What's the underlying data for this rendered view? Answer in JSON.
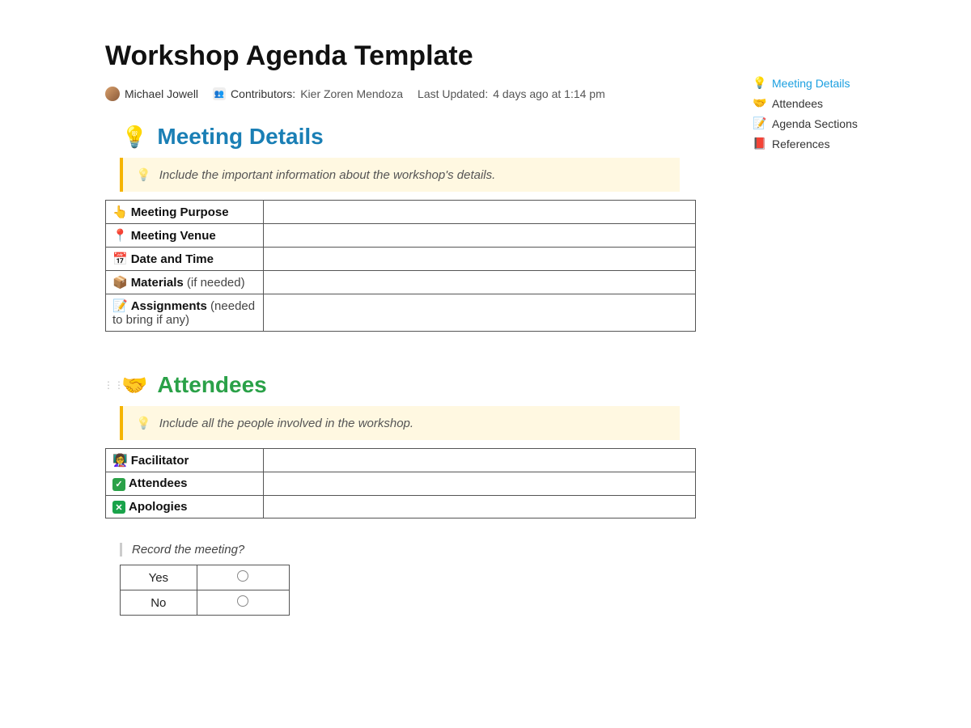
{
  "title": "Workshop Agenda Template",
  "meta": {
    "author": "Michael Jowell",
    "contributors_label": "Contributors:",
    "contributors": "Kier Zoren Mendoza",
    "updated_label": "Last Updated:",
    "updated_value": "4 days ago at 1:14 pm"
  },
  "toc": {
    "items": [
      {
        "icon": "💡",
        "label": "Meeting Details",
        "active": true
      },
      {
        "icon": "🤝",
        "label": "Attendees",
        "active": false
      },
      {
        "icon": "📝",
        "label": "Agenda Sections",
        "active": false
      },
      {
        "icon": "📕",
        "label": "References",
        "active": false
      }
    ]
  },
  "sections": {
    "meeting_details": {
      "icon": "💡",
      "title": "Meeting Details",
      "callout": "Include the important information about the workshop's details.",
      "rows": [
        {
          "icon": "👆",
          "label": "Meeting Purpose",
          "sub": "",
          "value": ""
        },
        {
          "icon": "📍",
          "label": "Meeting Venue",
          "sub": "",
          "value": ""
        },
        {
          "icon": "📅",
          "label": "Date and Time",
          "sub": "",
          "value": ""
        },
        {
          "icon": "📦",
          "label": "Materials",
          "sub": " (if needed)",
          "value": ""
        },
        {
          "icon": "📝",
          "label": "Assignments",
          "sub": " (needed to bring if any)",
          "value": ""
        }
      ]
    },
    "attendees": {
      "icon": "🤝",
      "title": "Attendees",
      "callout": "Include all the people involved in the workshop.",
      "rows": [
        {
          "icon": "👩‍🏫",
          "label": "Facilitator",
          "value": ""
        },
        {
          "icon": "check-green",
          "label": "Attendees",
          "value": ""
        },
        {
          "icon": "x-green",
          "label": "Apologies",
          "value": ""
        }
      ],
      "record_question": "Record the meeting?",
      "options": [
        {
          "label": "Yes"
        },
        {
          "label": "No"
        }
      ]
    }
  }
}
